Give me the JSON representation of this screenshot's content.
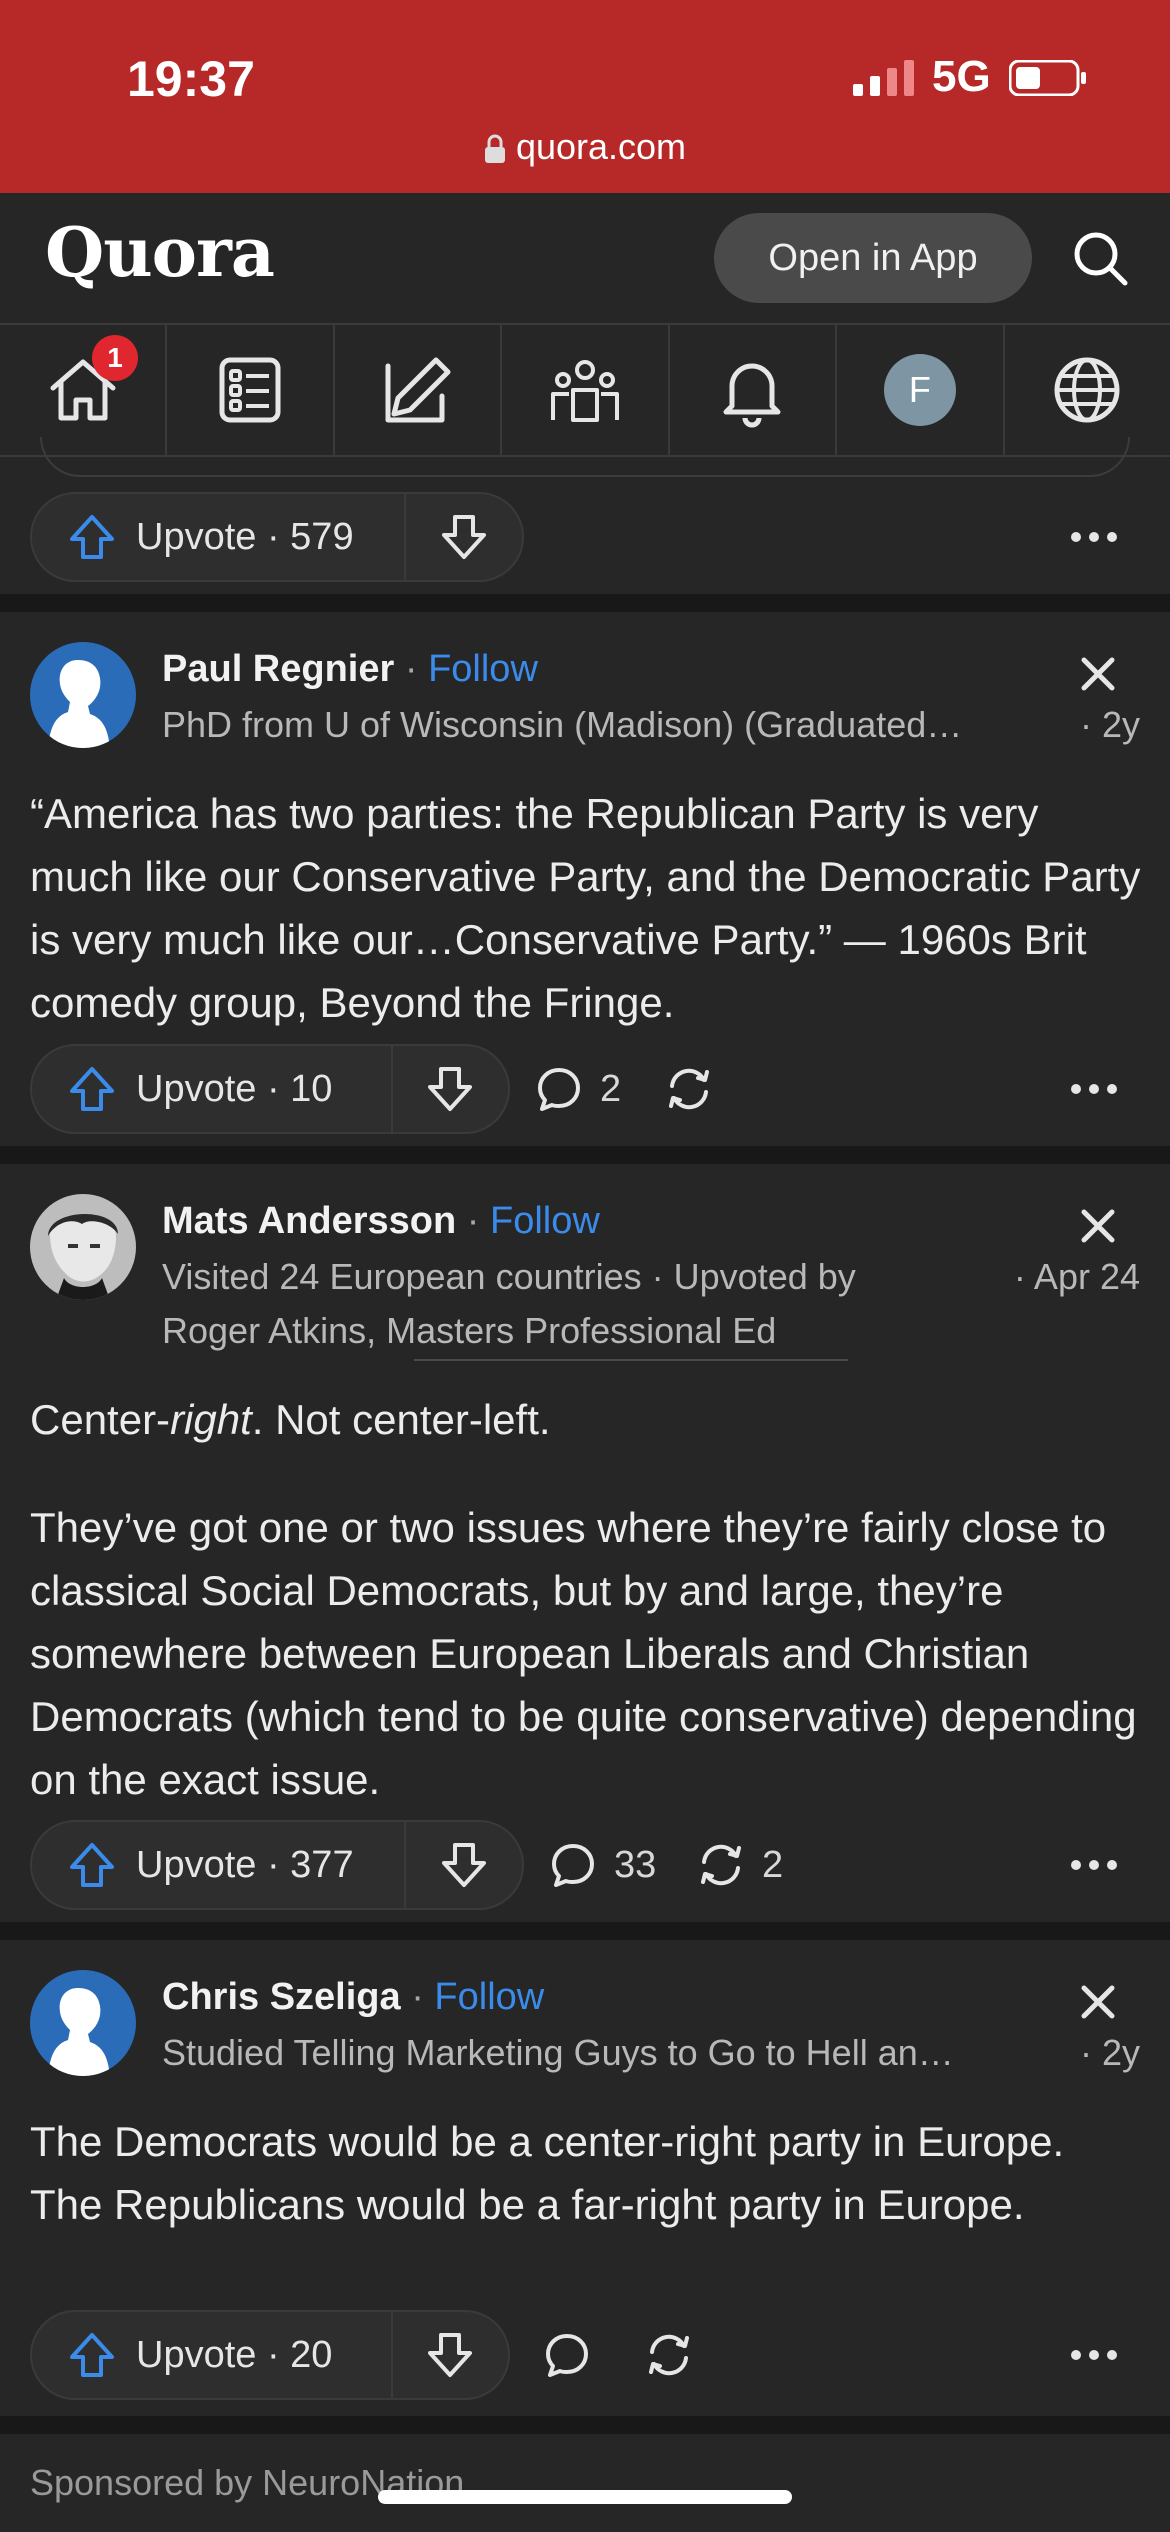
{
  "status_bar": {
    "time": "19:37",
    "network": "5G",
    "url": "quora.com",
    "bg_color": "#b72828"
  },
  "header": {
    "logo": "Quora",
    "open_in_app_label": "Open in App"
  },
  "nav": {
    "items": [
      "home-icon",
      "following-icon",
      "answer-icon",
      "spaces-icon",
      "notifications-icon",
      "profile-avatar",
      "language-icon"
    ],
    "home_badge": "1",
    "avatar_letter": "F"
  },
  "top_card": {
    "upvote_label": "Upvote · 579"
  },
  "answers": [
    {
      "author": "Paul Regnier",
      "follow_label": "Follow",
      "credential": "PhD from U of Wisconsin (Madison) (Graduated…",
      "date": "· 2y",
      "text": "“America has two parties: the Republican Party is very much like our Conservative Party, and the Democratic Party is very much like our…Conservative Party.” — 1960s Brit comedy group, Beyond the Fringe.",
      "upvote_label": "Upvote · 10",
      "comments": "2",
      "shares": ""
    },
    {
      "author": "Mats Andersson",
      "follow_label": "Follow",
      "credential": "Visited 24 European countries · Upvoted by",
      "credential_line2": "Roger Atkins, Masters Professional Ed",
      "date": "· Apr 24",
      "text_p1_before": "Center-",
      "text_p1_italic": "right",
      "text_p1_after": ". Not center-left.",
      "text_p2": "They’ve got one or two issues where they’re fairly close to classical Social Democrats, but by and large, they’re somewhere between European Liberals and Christian Democrats (which tend to be quite conservative) depending on the exact issue.",
      "upvote_label": "Upvote · 377",
      "comments": "33",
      "shares": "2"
    },
    {
      "author": "Chris Szeliga",
      "follow_label": "Follow",
      "credential": "Studied Telling Marketing Guys to Go to Hell an…",
      "date": "· 2y",
      "text": "The Democrats would be a center-right party in Europe. The Republicans would be a far-right party in Europe.",
      "upvote_label": "Upvote · 20",
      "comments": "",
      "shares": ""
    }
  ],
  "sponsored": "Sponsored by NeuroNation",
  "colors": {
    "accent_blue": "#3b8bea",
    "card_bg": "#262626",
    "page_bg": "#181818",
    "badge_red": "#e0262e"
  }
}
